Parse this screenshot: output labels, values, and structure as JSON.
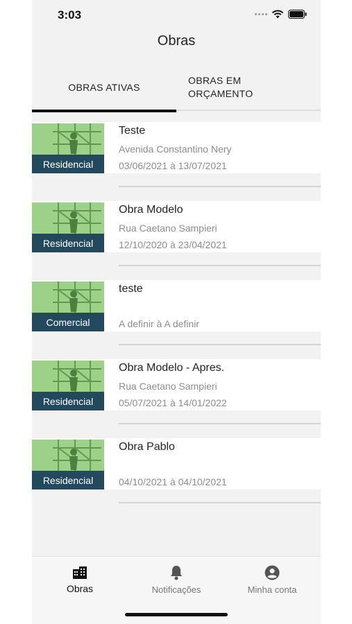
{
  "status_bar": {
    "time": "3:03",
    "signal_icon": "signal-dots-icon",
    "wifi_icon": "wifi-icon",
    "battery_icon": "battery-icon"
  },
  "header": {
    "title": "Obras"
  },
  "tabs": [
    {
      "label": "OBRAS ATIVAS",
      "active": true
    },
    {
      "label": "OBRAS EM ORÇAMENTO",
      "active": false
    }
  ],
  "obras": [
    {
      "title": "Teste",
      "category": "Residencial",
      "address": "Avenida Constantino Nery",
      "dates": "03/06/2021 à 13/07/2021"
    },
    {
      "title": "Obra Modelo",
      "category": "Residencial",
      "address": "Rua Caetano Sampieri",
      "dates": "12/10/2020 à 23/04/2021"
    },
    {
      "title": "teste",
      "category": "Comercial",
      "address": "",
      "dates": "A definir à A definir"
    },
    {
      "title": "Obra Modelo - Apres.",
      "category": "Residencial",
      "address": "Rua Caetano Sampieri",
      "dates": "05/07/2021 à 14/01/2022"
    },
    {
      "title": "Obra Pablo",
      "category": "Residencial",
      "address": "",
      "dates": "04/10/2021 à 04/10/2021"
    }
  ],
  "bottom_nav": [
    {
      "label": "Obras",
      "icon": "buildings-icon",
      "active": true
    },
    {
      "label": "Notificações",
      "icon": "bell-icon",
      "active": false
    },
    {
      "label": "Minha conta",
      "icon": "account-circle-icon",
      "active": false
    }
  ],
  "colors": {
    "thumb_label_bg": "#23495e",
    "thumb_bg": "#8ec47a",
    "active_tab": "#111111"
  }
}
